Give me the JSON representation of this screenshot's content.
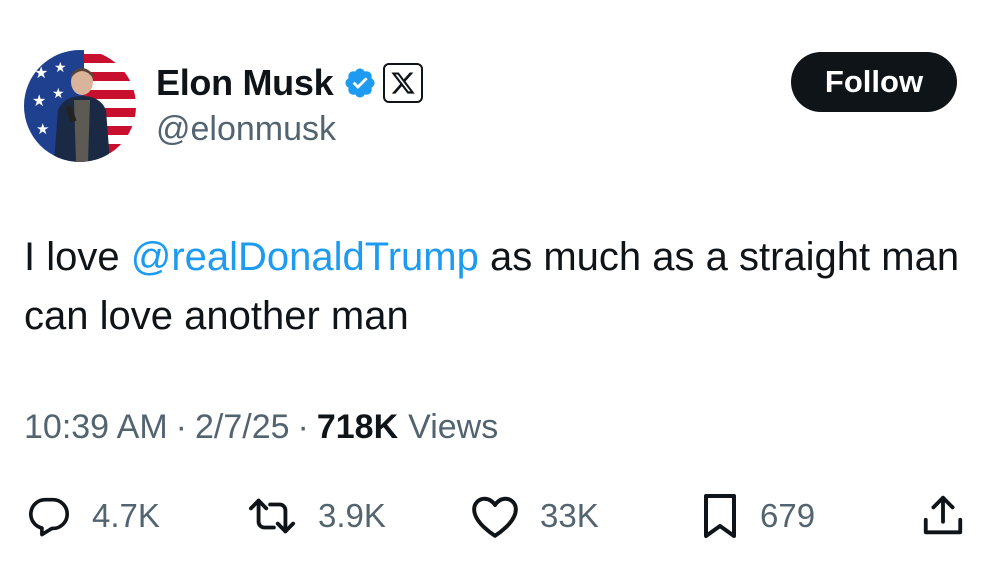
{
  "author": {
    "name": "Elon Musk",
    "handle": "@elonmusk",
    "avatar_icon": "person-with-flag-backdrop",
    "verified_icon": "verified-badge-icon",
    "affiliation_icon": "x-logo-icon"
  },
  "follow_label": "Follow",
  "tweet": {
    "text_prefix": "I love ",
    "mention": "@realDonaldTrump",
    "text_suffix": " as much as a straight man can love another man"
  },
  "meta": {
    "time": "10:39 AM",
    "date": "2/7/25",
    "separator": "·",
    "views_count": "718K",
    "views_label": "Views"
  },
  "actions": {
    "replies": "4.7K",
    "reposts": "3.9K",
    "likes": "33K",
    "bookmarks": "679"
  },
  "colors": {
    "accent": "#1d9bf0",
    "text": "#0f1419",
    "muted": "#536471",
    "button_bg": "#0f1419"
  }
}
